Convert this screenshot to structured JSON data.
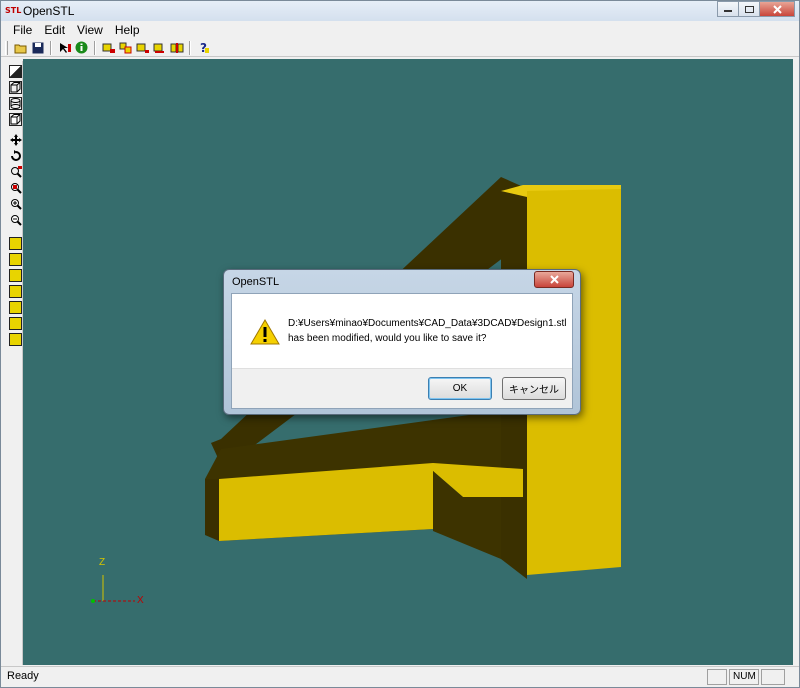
{
  "window": {
    "title": "OpenSTL",
    "icon_label": "STL",
    "controls": [
      "minimize",
      "maximize",
      "close"
    ]
  },
  "menu": {
    "items": [
      "File",
      "Edit",
      "View",
      "Help"
    ]
  },
  "toolbar": {
    "icons": [
      "open-icon",
      "save-icon",
      "select-icon",
      "info-icon",
      "tool-1-icon",
      "tool-2-icon",
      "tool-3-icon",
      "tool-4-icon",
      "tool-5-icon",
      "help-icon"
    ]
  },
  "side_toolbar": {
    "icons": [
      "shade-icon",
      "wireframe-icon",
      "cylinder-icon",
      "box-icon",
      "pan-icon",
      "rotate-icon",
      "zoom-window-icon",
      "zoom-all-icon",
      "zoom-in-icon",
      "zoom-out-icon",
      "view-front-icon",
      "view-back-icon",
      "view-left-icon",
      "view-right-icon",
      "view-top-icon",
      "view-bottom-icon",
      "view-iso-icon"
    ]
  },
  "viewport": {
    "background": "#366d6d",
    "model_color": "#dbbd00",
    "axis_labels": {
      "z": "Z",
      "x": "X"
    }
  },
  "dialog": {
    "title": "OpenSTL",
    "close_label": "X",
    "message_line1": "D:¥Users¥minao¥Documents¥CAD_Data¥3DCAD¥Design1.stl",
    "message_line2": "has been modified, would you like to save it?",
    "ok_label": "OK",
    "cancel_label": "キャンセル"
  },
  "status": {
    "text": "Ready",
    "indicator": "NUM"
  }
}
